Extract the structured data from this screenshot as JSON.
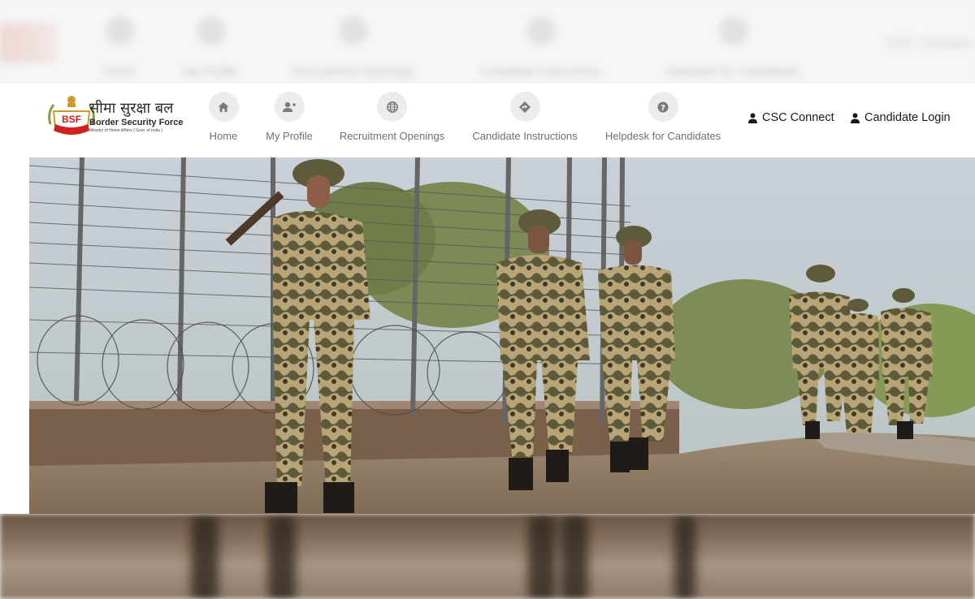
{
  "brand": {
    "logo_text": "BSF",
    "name_hindi": "सीमा सुरक्षा बल",
    "name_english": "Border Security Force",
    "ministry": "Ministry of Home Affairs ( Govt. of India )"
  },
  "nav": {
    "items": [
      {
        "label": "Home",
        "icon": "home-icon"
      },
      {
        "label": "My Profile",
        "icon": "user-plus-icon"
      },
      {
        "label": "Recruitment Openings",
        "icon": "globe-icon"
      },
      {
        "label": "Candidate Instructions",
        "icon": "direction-sign-icon"
      },
      {
        "label": "Helpdesk for Candidates",
        "icon": "question-icon"
      }
    ]
  },
  "header_links": {
    "csc_connect": "CSC Connect",
    "candidate_login": "Candidate Login"
  },
  "hero": {
    "image": "bsf-soldiers-patrolling-border-fence"
  },
  "colors": {
    "nav_label": "#6f6f6f",
    "nav_circle": "#ececec",
    "brand_red": "#d0221c",
    "brand_gold": "#c99a2e"
  }
}
